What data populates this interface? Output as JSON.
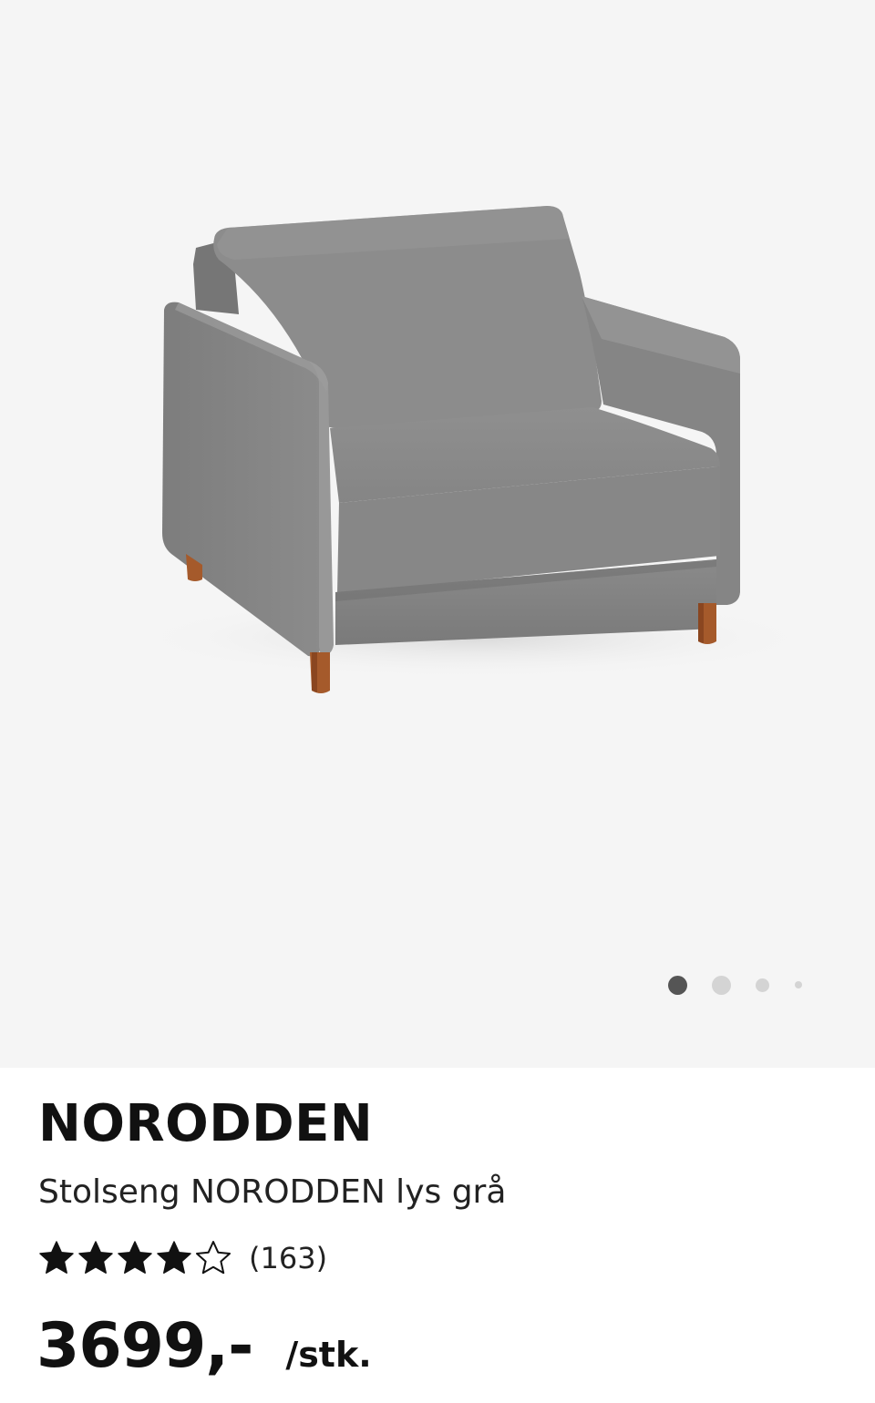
{
  "product": {
    "name": "NORODDEN",
    "description": "Stolseng NORODDEN lys grå",
    "rating": {
      "stars": 4,
      "max_stars": 5,
      "review_count": "(163)"
    },
    "price": "3699,-",
    "price_unit": "/stk."
  },
  "gallery": {
    "image": "armchair-sofa-bed",
    "image_count": 4,
    "active_index": 0
  },
  "colors": {
    "gallery_background": "#f5f5f5",
    "dot_active": "#555555",
    "dot_inactive": "#d4d4d4",
    "text": "#111111",
    "fabric": "#848484",
    "legs": "#a55a2b"
  }
}
